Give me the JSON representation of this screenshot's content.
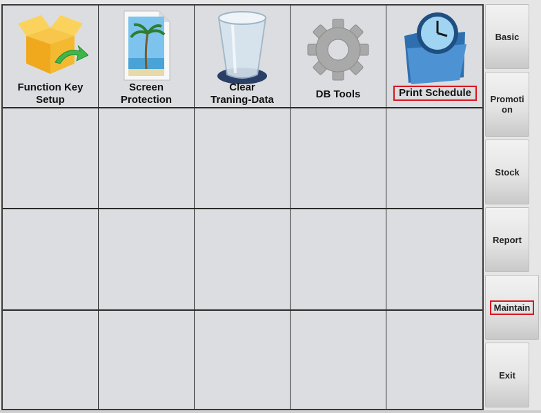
{
  "tiles": [
    {
      "label_line1": "Function Key",
      "label_line2": "Setup",
      "icon": "open-box-icon"
    },
    {
      "label_line1": "Screen",
      "label_line2": "Protection",
      "icon": "palm-tree-document-icon"
    },
    {
      "label_line1": "Clear",
      "label_line2": "Traning-Data",
      "icon": "trash-bin-icon"
    },
    {
      "label_line1": "DB Tools",
      "icon": "gear-icon"
    },
    {
      "label_line1": "Print Schedule",
      "icon": "clock-folder-icon"
    }
  ],
  "sidebar": {
    "basic": "Basic",
    "promotion_line1": "Promoti",
    "promotion_line2": "on",
    "stock": "Stock",
    "report": "Report",
    "maintain": "Maintain",
    "exit": "Exit"
  },
  "colors": {
    "highlight": "#d9161e",
    "grid_background": "#dcdde0"
  }
}
